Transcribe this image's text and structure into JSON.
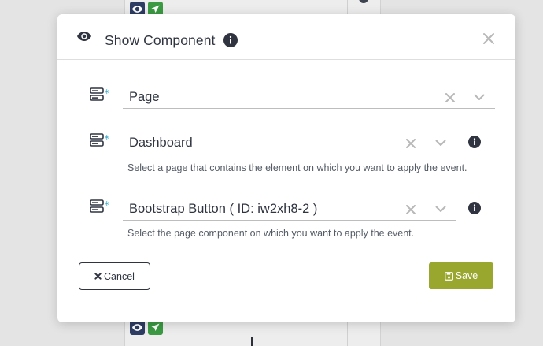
{
  "modal": {
    "title": "Show Component",
    "fields": [
      {
        "value": "Page",
        "required_marker": "*",
        "help": ""
      },
      {
        "value": "Dashboard",
        "required_marker": "*",
        "help": "Select a page that contains the element on which you want to apply the event."
      },
      {
        "value": "Bootstrap Button ( ID: iw2xh8-2 )",
        "required_marker": "*",
        "help": "Select the page component on which you want to apply the event."
      }
    ],
    "cancel_label": "Cancel",
    "save_label": "Save"
  },
  "icons": {
    "title": "eye-icon",
    "title_info": "info-circle-icon",
    "close": "close-icon",
    "field": "server-rows-icon",
    "clear": "clear-x-icon",
    "dropdown": "chevron-down-icon",
    "cancel": "times-icon",
    "save": "floppy-disk-icon"
  },
  "colors": {
    "save_button": "#9aa72f",
    "required_marker": "#3aa8c8",
    "text": "#2f3440",
    "backdrop": "#e4e4e4"
  }
}
